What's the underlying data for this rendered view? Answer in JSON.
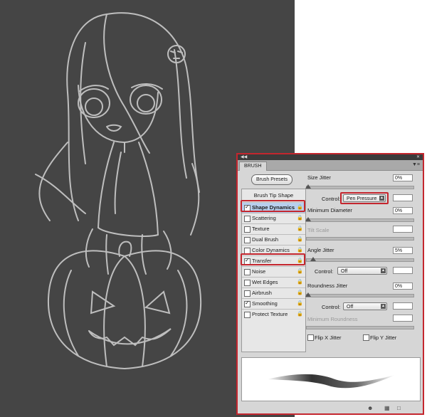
{
  "panel": {
    "title": "BRUSH",
    "presets_button": "Brush Presets",
    "tip_shape_header": "Brush Tip Shape",
    "options": [
      {
        "label": "Shape Dynamics",
        "checked": true,
        "selected": true
      },
      {
        "label": "Scattering",
        "checked": false
      },
      {
        "label": "Texture",
        "checked": false
      },
      {
        "label": "Dual Brush",
        "checked": false
      },
      {
        "label": "Color Dynamics",
        "checked": false
      },
      {
        "label": "Transfer",
        "checked": true
      },
      {
        "label": "Noise",
        "checked": false
      },
      {
        "label": "Wet Edges",
        "checked": false
      },
      {
        "label": "Airbrush",
        "checked": false
      },
      {
        "label": "Smoothing",
        "checked": true
      },
      {
        "label": "Protect Texture",
        "checked": false
      }
    ],
    "size_jitter": {
      "label": "Size Jitter",
      "value": "0%",
      "control_label": "Control:",
      "control_value": "Pen Pressure"
    },
    "minimum_diameter": {
      "label": "Minimum Diameter",
      "value": "0%"
    },
    "tilt_scale": {
      "label": "Tilt Scale",
      "value": ""
    },
    "angle_jitter": {
      "label": "Angle Jitter",
      "value": "5%",
      "control_label": "Control:",
      "control_value": "Off"
    },
    "roundness_jitter": {
      "label": "Roundness Jitter",
      "value": "0%",
      "control_label": "Control:",
      "control_value": "Off"
    },
    "minimum_roundness": {
      "label": "Minimum Roundness",
      "value": ""
    },
    "flip_x": {
      "label": "Flip X Jitter",
      "checked": false
    },
    "flip_y": {
      "label": "Flip Y Jitter",
      "checked": false
    },
    "highlight_color": "#c4262e"
  }
}
